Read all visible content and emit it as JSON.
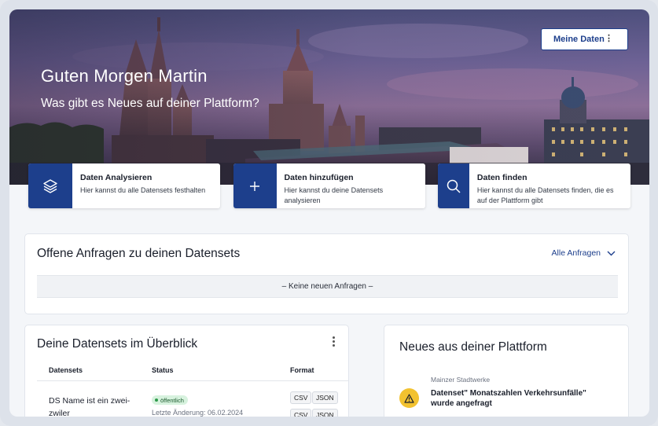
{
  "hero": {
    "greeting": "Guten Morgen Martin",
    "subtitle": "Was gibt es Neues auf deiner Plattform?",
    "my_data_button": "Meine Daten",
    "kebab": "⋮"
  },
  "actions": [
    {
      "title": "Daten Analysieren",
      "desc": "Hier kannst du alle Datensets festhalten",
      "icon": "layers-icon"
    },
    {
      "title": "Daten hinzufügen",
      "desc": "Hier kannst du deine Datensets analysieren",
      "icon": "plus-icon"
    },
    {
      "title": "Daten finden",
      "desc": "Hier kannst du alle Datensets finden, die es auf der Plattform gibt",
      "icon": "search-icon"
    }
  ],
  "requests": {
    "title": "Offene Anfragen zu deinen Datensets",
    "all_link": "Alle Anfragen",
    "empty": "– Keine neuen Anfragen –"
  },
  "datasets": {
    "title": "Deine Datensets im Überblick",
    "columns": [
      "Datensets",
      "Status",
      "Format"
    ],
    "rows": [
      {
        "name": "DS Name ist ein zwei-zwiler",
        "status": "öffentlich",
        "last_change": "Letzte Änderung: 06.02.2024",
        "formats": [
          "CSV",
          "JSON",
          "CSV",
          "JSON"
        ]
      }
    ]
  },
  "news": {
    "title": "Neues aus deiner Plattform",
    "items": [
      {
        "source": "Mainzer Stadtwerke",
        "text": "Datenset\" Monatszahlen Verkehrsunfälle\" wurde angefragt",
        "icon": "warning-icon"
      }
    ]
  },
  "colors": {
    "primary": "#1d3f8c",
    "badge_bg": "#d7f2de",
    "warning": "#f2c230"
  }
}
